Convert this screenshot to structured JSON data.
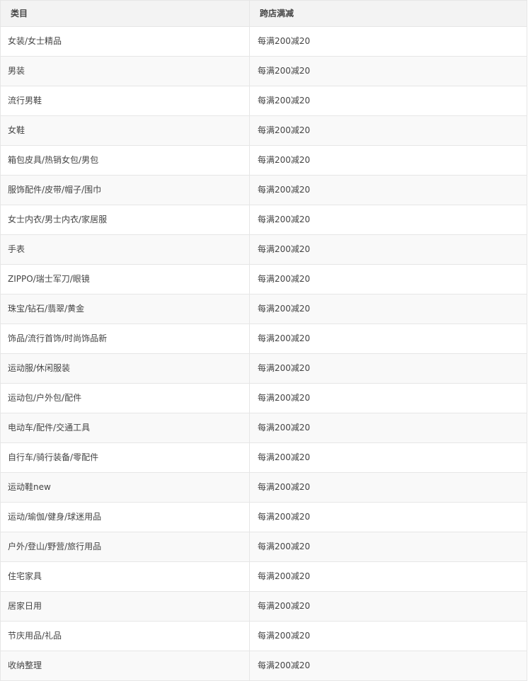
{
  "table": {
    "headers": {
      "category": "类目",
      "discount": "跨店满减"
    },
    "rows": [
      {
        "category": "女装/女士精品",
        "discount": "每满200减20"
      },
      {
        "category": "男装",
        "discount": "每满200减20"
      },
      {
        "category": "流行男鞋",
        "discount": "每满200减20"
      },
      {
        "category": "女鞋",
        "discount": "每满200减20"
      },
      {
        "category": "箱包皮具/热销女包/男包",
        "discount": "每满200减20"
      },
      {
        "category": "服饰配件/皮带/帽子/围巾",
        "discount": "每满200减20"
      },
      {
        "category": "女士内衣/男士内衣/家居服",
        "discount": "每满200减20"
      },
      {
        "category": "手表",
        "discount": "每满200减20"
      },
      {
        "category": "ZIPPO/瑞士军刀/眼镜",
        "discount": "每满200减20"
      },
      {
        "category": "珠宝/钻石/翡翠/黄金",
        "discount": "每满200减20"
      },
      {
        "category": "饰品/流行首饰/时尚饰品新",
        "discount": "每满200减20"
      },
      {
        "category": "运动服/休闲服装",
        "discount": "每满200减20"
      },
      {
        "category": "运动包/户外包/配件",
        "discount": "每满200减20"
      },
      {
        "category": "电动车/配件/交通工具",
        "discount": "每满200减20"
      },
      {
        "category": "自行车/骑行装备/零配件",
        "discount": "每满200减20"
      },
      {
        "category": "运动鞋new",
        "discount": "每满200减20"
      },
      {
        "category": "运动/瑜伽/健身/球迷用品",
        "discount": "每满200减20"
      },
      {
        "category": "户外/登山/野营/旅行用品",
        "discount": "每满200减20"
      },
      {
        "category": "住宅家具",
        "discount": "每满200减20"
      },
      {
        "category": "居家日用",
        "discount": "每满200减20"
      },
      {
        "category": "节庆用品/礼品",
        "discount": "每满200减20"
      },
      {
        "category": "收纳整理",
        "discount": "每满200减20"
      }
    ]
  }
}
